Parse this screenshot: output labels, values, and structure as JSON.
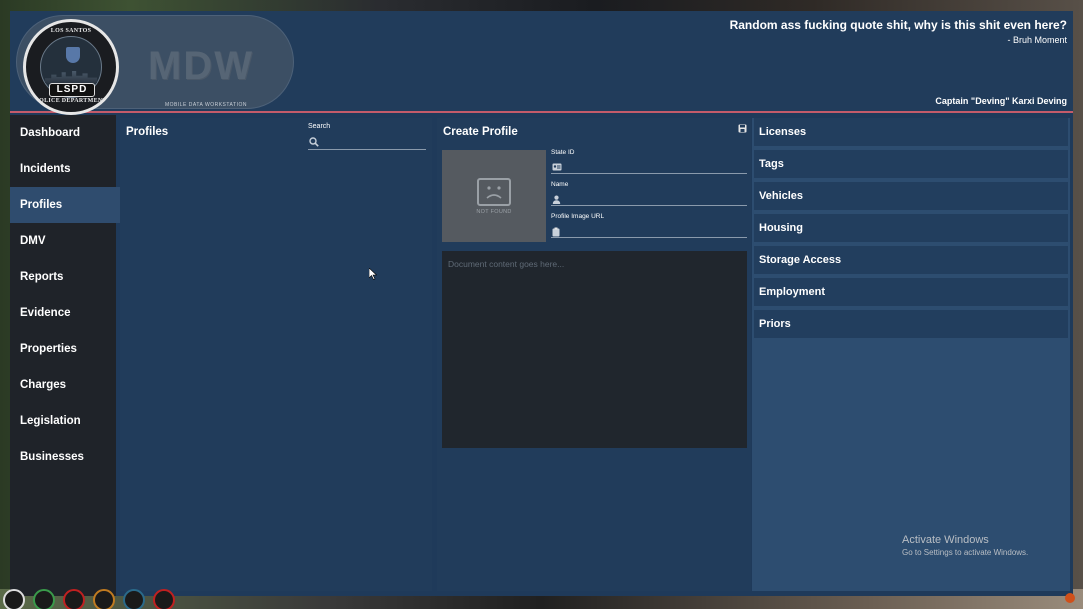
{
  "header": {
    "badge_top": "LOS SANTOS",
    "badge_mid": "LSPD",
    "badge_bottom": "POLICE DEPARTMENT",
    "app_logo": "MDW",
    "app_subtitle": "MOBILE DATA WORKSTATION",
    "quote": "Random ass fucking quote shit, why is this shit even here?",
    "quote_author": "- Bruh Moment",
    "officer": "Captain \"Deving\" Karxi Deving"
  },
  "sidebar": {
    "active": "Profiles",
    "items": [
      {
        "label": "Dashboard"
      },
      {
        "label": "Incidents"
      },
      {
        "label": "Profiles"
      },
      {
        "label": "DMV"
      },
      {
        "label": "Reports"
      },
      {
        "label": "Evidence"
      },
      {
        "label": "Properties"
      },
      {
        "label": "Charges"
      },
      {
        "label": "Legislation"
      },
      {
        "label": "Businesses"
      }
    ]
  },
  "profiles_panel": {
    "title": "Profiles",
    "search_label": "Search",
    "search_value": ""
  },
  "create_panel": {
    "title": "Create Profile",
    "image_placeholder": "NOT FOUND",
    "state_id_label": "State ID",
    "name_label": "Name",
    "image_url_label": "Profile Image URL",
    "document_placeholder": "Document content goes here..."
  },
  "right_panel": {
    "sections": [
      "Licenses",
      "Tags",
      "Vehicles",
      "Housing",
      "Storage Access",
      "Employment",
      "Priors"
    ]
  },
  "watermark": {
    "title": "Activate Windows",
    "subtitle": "Go to Settings to activate Windows."
  },
  "icons": {
    "search": "search-icon",
    "save": "save-icon",
    "id_card": "id-card-icon",
    "user": "user-icon",
    "clipboard": "clipboard-icon",
    "sad_face": "sad-face-icon"
  },
  "colors": {
    "header_bg": "#213c5b",
    "accent_line": "#c45b6a",
    "sidebar_bg": "#1f2329",
    "active_nav": "#2f4c6e",
    "panel_bg": "#213c5b",
    "right_panel_bg": "#2d4d70"
  }
}
